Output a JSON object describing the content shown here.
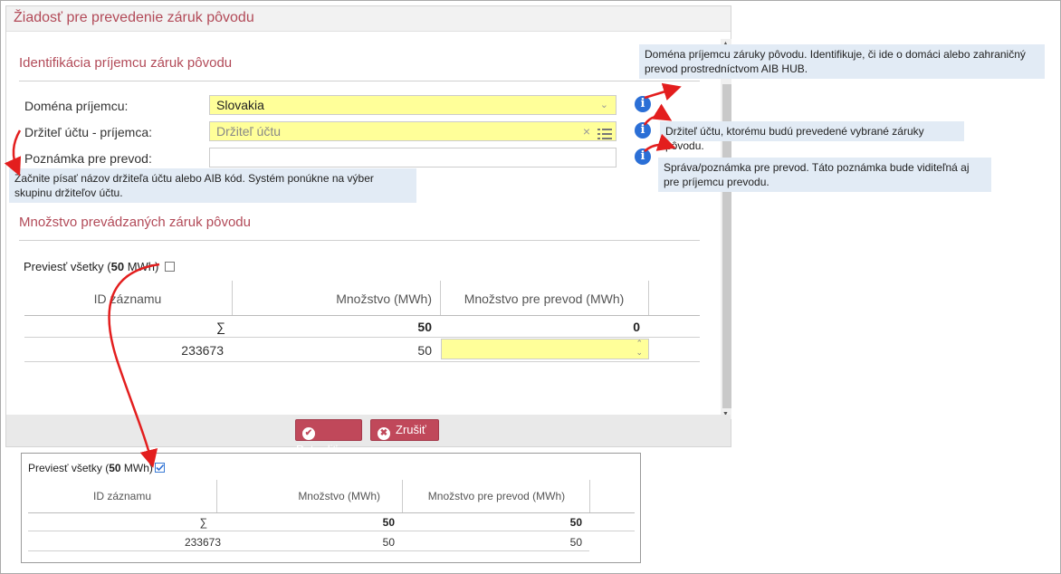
{
  "dialog": {
    "title": "Žiadosť pre prevedenie záruk pôvodu",
    "section1_title": "Identifikácia príjemcu záruk pôvodu",
    "domain_label": "Doména príjemcu:",
    "domain_value": "Slovakia",
    "holder_label": "Držiteľ účtu - príjemca:",
    "holder_placeholder": "Držiteľ účtu",
    "note_label": "Poznámka pre prevod:",
    "section2_title": "Množstvo prevádzaných záruk pôvodu",
    "transfer_all_prefix": "Previesť všetky (",
    "transfer_all_amount": "50",
    "transfer_all_suffix": " MWh)",
    "table": {
      "headers": [
        "ID záznamu",
        "Množstvo (MWh)",
        "Množstvo pre prevod (MWh)"
      ],
      "sum_symbol": "∑",
      "sum_quantity": "50",
      "sum_transfer": "0",
      "rows": [
        {
          "id": "233673",
          "quantity": "50",
          "transfer": ""
        }
      ]
    },
    "confirm_label": "Potvrdiť",
    "cancel_label": "Zrušiť"
  },
  "tooltips": {
    "domain": "Doména príjemcu záruky pôvodu. Identifikuje, či ide o domáci alebo zahraničný prevod prostredníctvom AIB HUB.",
    "holder": "Držiteľ účtu, ktorému budú prevedené vybrané záruky pôvodu.",
    "note": "Správa/poznámka pre prevod. Táto poznámka bude viditeľná aj pre príjemcu prevodu.",
    "holder_hint": "Začnite písať názov držiteľa účtu alebo AIB kód. Systém ponúkne na výber skupinu držiteľov účtu."
  },
  "panel2": {
    "transfer_all_prefix": "Previesť všetky (",
    "transfer_all_amount": "50",
    "transfer_all_suffix": " MWh)",
    "checked": true,
    "headers": [
      "ID záznamu",
      "Množstvo (MWh)",
      "Množstvo pre prevod (MWh)"
    ],
    "sum_symbol": "∑",
    "sum_quantity": "50",
    "sum_transfer": "50",
    "rows": [
      {
        "id": "233673",
        "quantity": "50",
        "transfer": "50"
      }
    ]
  },
  "colors": {
    "accent": "#b24a58",
    "button": "#c0485a",
    "info_icon": "#2b6fd6",
    "arrow": "#e31e1e",
    "highlight": "#ffff99",
    "tooltip_bg": "#e2ebf5"
  }
}
